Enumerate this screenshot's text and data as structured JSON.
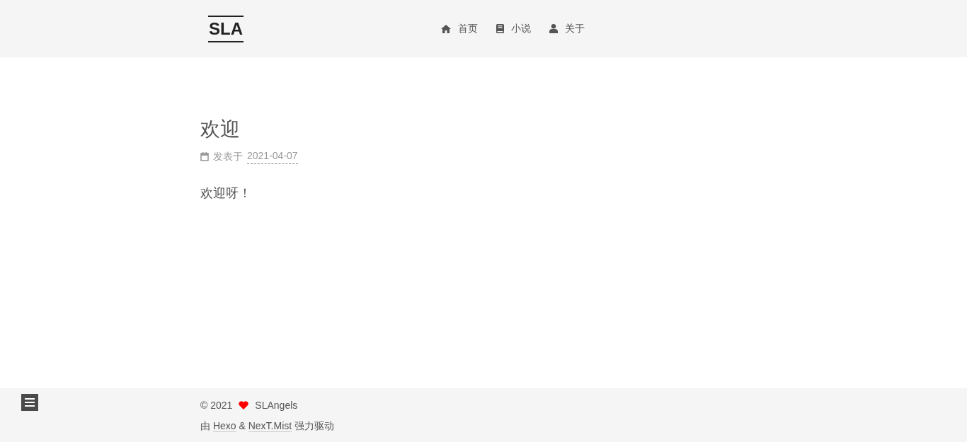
{
  "header": {
    "logo": "SLA",
    "nav": [
      {
        "kind": "home",
        "label": "首页"
      },
      {
        "kind": "book",
        "label": "小说"
      },
      {
        "kind": "user",
        "label": "关于"
      }
    ]
  },
  "post": {
    "title": "欢迎",
    "meta_label": "发表于",
    "date": "2021-04-07",
    "body": "欢迎呀！"
  },
  "footer": {
    "year": "© 2021",
    "author": "SLAngels",
    "powered_prefix": "由",
    "powered_links": [
      "Hexo",
      "NexT.Mist"
    ],
    "powered_joiner": "&",
    "powered_suffix": "强力驱动"
  }
}
